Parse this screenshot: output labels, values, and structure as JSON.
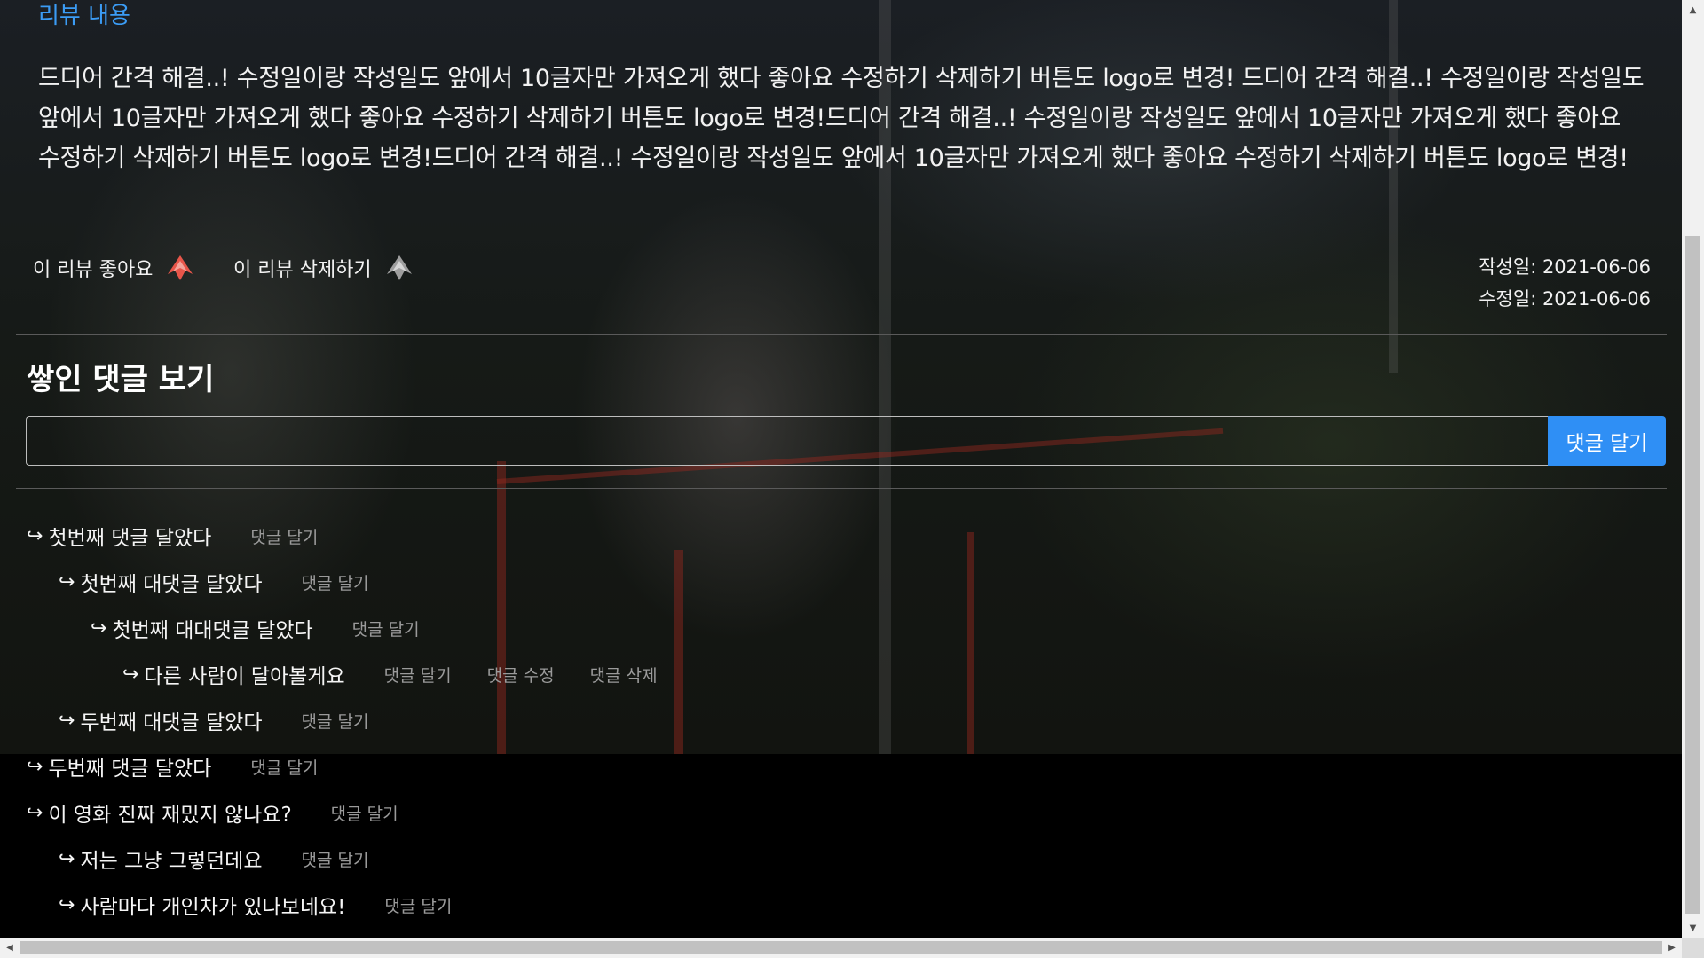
{
  "review": {
    "section_title": "리뷰 내용",
    "body": "드디어 간격 해결..! 수정일이랑 작성일도 앞에서 10글자만 가져오게 했다 좋아요 수정하기 삭제하기 버튼도 logo로 변경! 드디어 간격 해결..! 수정일이랑 작성일도 앞에서 10글자만 가져오게 했다 좋아요 수정하기 삭제하기 버튼도 logo로 변경!드디어 간격 해결..! 수정일이랑 작성일도 앞에서 10글자만 가져오게 했다 좋아요 수정하기 삭제하기 버튼도 logo로 변경!드디어 간격 해결..! 수정일이랑 작성일도 앞에서 10글자만 가져오게 했다 좋아요 수정하기 삭제하기 버튼도 logo로 변경!",
    "like_label": "이 리뷰 좋아요",
    "delete_label": "이 리뷰 삭제하기",
    "created": "작성일: 2021-06-06",
    "modified": "수정일: 2021-06-06",
    "like_icon": "like-logo-icon",
    "delete_icon": "delete-logo-icon",
    "like_icon_color": "#e8564a",
    "delete_icon_color": "#9e9e9e"
  },
  "comments": {
    "title": "쌓인 댓글 보기",
    "input_placeholder": "",
    "submit_label": "댓글 달기",
    "accent_color": "#2f8ff5",
    "arrow": "↪",
    "items": [
      {
        "text": "첫번째 댓글 달았다",
        "depth": 0,
        "actions": [
          "댓글 달기"
        ]
      },
      {
        "text": "첫번째 대댓글 달았다",
        "depth": 1,
        "actions": [
          "댓글 달기"
        ]
      },
      {
        "text": "첫번째 대대댓글 달았다",
        "depth": 2,
        "actions": [
          "댓글 달기"
        ]
      },
      {
        "text": "다른 사람이 달아볼게요",
        "depth": 3,
        "actions": [
          "댓글 달기",
          "댓글 수정",
          "댓글 삭제"
        ]
      },
      {
        "text": "두번째 대댓글 달았다",
        "depth": 1,
        "actions": [
          "댓글 달기"
        ]
      },
      {
        "text": "두번째 댓글 달았다",
        "depth": 0,
        "actions": [
          "댓글 달기"
        ]
      },
      {
        "text": "이 영화 진짜 재밌지 않나요?",
        "depth": 0,
        "actions": [
          "댓글 달기"
        ]
      },
      {
        "text": "저는 그냥 그렇던데요",
        "depth": 1,
        "actions": [
          "댓글 달기"
        ]
      },
      {
        "text": "사람마다 개인차가 있나보네요!",
        "depth": 1,
        "actions": [
          "댓글 달기"
        ]
      }
    ]
  }
}
